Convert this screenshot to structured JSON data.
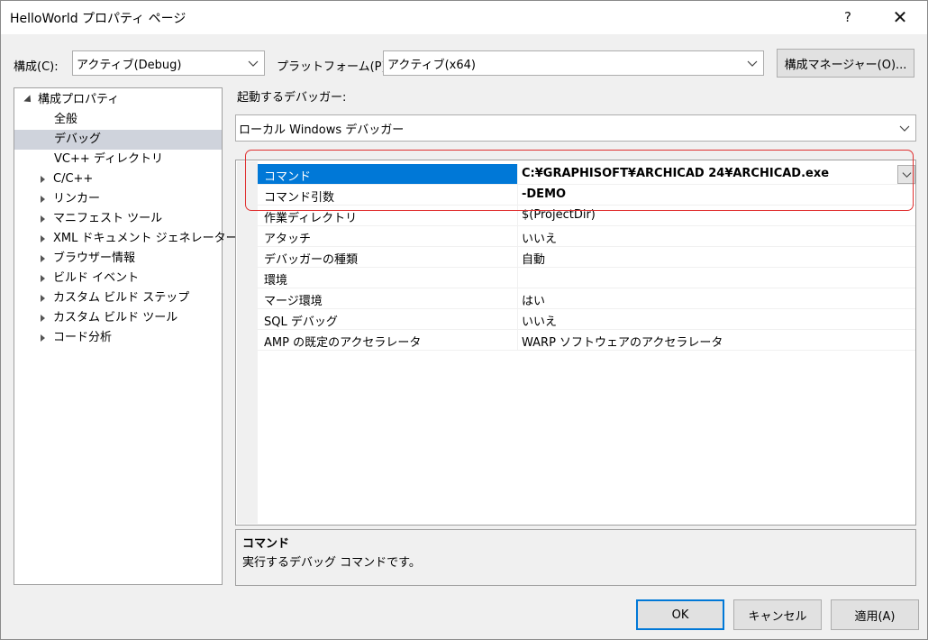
{
  "window": {
    "title": "HelloWorld プロパティ ページ",
    "help": "?",
    "close": "✕"
  },
  "config_bar": {
    "config_label": "構成(C):",
    "config_value": "アクティブ(Debug)",
    "platform_label": "プラットフォーム(P):",
    "platform_value": "アクティブ(x64)",
    "manager_button": "構成マネージャー(O)..."
  },
  "tree": {
    "root": "構成プロパティ",
    "items": [
      {
        "label": "全般",
        "expandable": false,
        "selected": false
      },
      {
        "label": "デバッグ",
        "expandable": false,
        "selected": true
      },
      {
        "label": "VC++ ディレクトリ",
        "expandable": false,
        "selected": false
      },
      {
        "label": "C/C++",
        "expandable": true,
        "selected": false
      },
      {
        "label": "リンカー",
        "expandable": true,
        "selected": false
      },
      {
        "label": "マニフェスト ツール",
        "expandable": true,
        "selected": false
      },
      {
        "label": "XML ドキュメント ジェネレーター",
        "expandable": true,
        "selected": false
      },
      {
        "label": "ブラウザー情報",
        "expandable": true,
        "selected": false
      },
      {
        "label": "ビルド イベント",
        "expandable": true,
        "selected": false
      },
      {
        "label": "カスタム ビルド ステップ",
        "expandable": true,
        "selected": false
      },
      {
        "label": "カスタム ビルド ツール",
        "expandable": true,
        "selected": false
      },
      {
        "label": "コード分析",
        "expandable": true,
        "selected": false
      }
    ]
  },
  "debugger": {
    "label": "起動するデバッガー:",
    "value": "ローカル Windows デバッガー"
  },
  "properties": [
    {
      "name": "コマンド",
      "value": "C:¥GRAPHISOFT¥ARCHICAD 24¥ARCHICAD.exe",
      "selected": true,
      "bold": true
    },
    {
      "name": "コマンド引数",
      "value": "-DEMO",
      "selected": false,
      "bold": true
    },
    {
      "name": "作業ディレクトリ",
      "value": "$(ProjectDir)",
      "selected": false,
      "bold": false
    },
    {
      "name": "アタッチ",
      "value": "いいえ",
      "selected": false,
      "bold": false
    },
    {
      "name": "デバッガーの種類",
      "value": "自動",
      "selected": false,
      "bold": false
    },
    {
      "name": "環境",
      "value": "",
      "selected": false,
      "bold": false
    },
    {
      "name": "マージ環境",
      "value": "はい",
      "selected": false,
      "bold": false
    },
    {
      "name": "SQL デバッグ",
      "value": "いいえ",
      "selected": false,
      "bold": false
    },
    {
      "name": "AMP の既定のアクセラレータ",
      "value": "WARP ソフトウェアのアクセラレータ",
      "selected": false,
      "bold": false
    }
  ],
  "description": {
    "title": "コマンド",
    "text": "実行するデバッグ コマンドです。"
  },
  "buttons": {
    "ok": "OK",
    "cancel": "キャンセル",
    "apply": "適用(A)"
  },
  "colors": {
    "selection": "#0078d7",
    "highlight_border": "#e03030",
    "tree_selection": "#cfd3dc"
  }
}
